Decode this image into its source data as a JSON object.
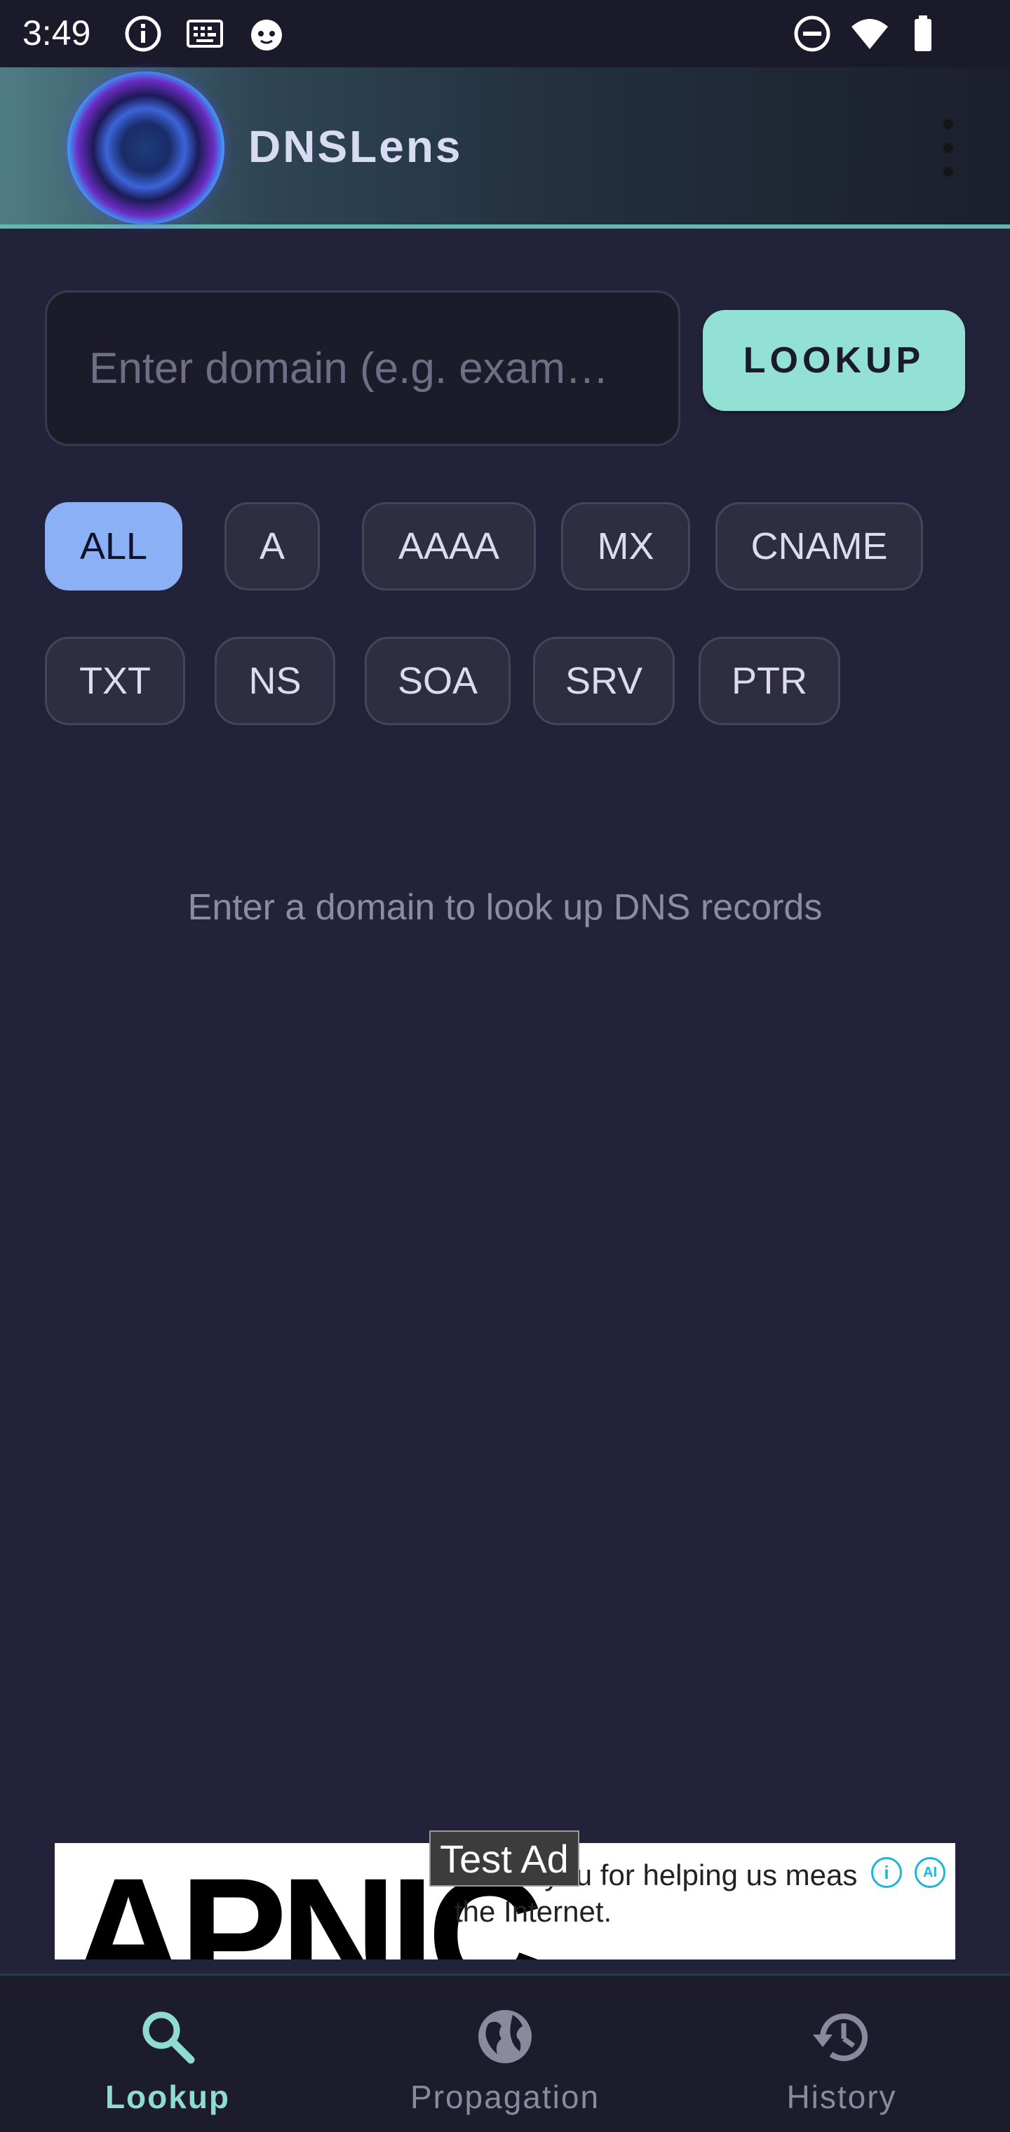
{
  "status_bar": {
    "time": "3:49",
    "left_icons": [
      "info-icon",
      "keyboard-icon",
      "cat-icon"
    ],
    "right_icons": [
      "do-not-disturb-icon",
      "wifi-icon",
      "battery-icon"
    ]
  },
  "app_bar": {
    "title": "DNSLens",
    "menu_icon": "more-vert-icon"
  },
  "search": {
    "placeholder": "Enter domain (e.g. exam…",
    "value": "",
    "button_label": "LOOKUP"
  },
  "record_types": [
    {
      "label": "ALL",
      "selected": true
    },
    {
      "label": "A",
      "selected": false
    },
    {
      "label": "AAAA",
      "selected": false
    },
    {
      "label": "MX",
      "selected": false
    },
    {
      "label": "CNAME",
      "selected": false
    },
    {
      "label": "TXT",
      "selected": false
    },
    {
      "label": "NS",
      "selected": false
    },
    {
      "label": "SOA",
      "selected": false
    },
    {
      "label": "SRV",
      "selected": false
    },
    {
      "label": "PTR",
      "selected": false
    }
  ],
  "empty_state": "Enter a domain to look up DNS records",
  "ad": {
    "badge": "Test Ad",
    "brand": "APNIC",
    "text_line1": "Thank you for helping us meas",
    "text_line2": "the Internet.",
    "info_icon": "ad-info-icon",
    "adchoices_icon": "adchoices-icon"
  },
  "bottom_nav": [
    {
      "label": "Lookup",
      "icon": "search-icon",
      "active": true
    },
    {
      "label": "Propagation",
      "icon": "globe-icon",
      "active": false
    },
    {
      "label": "History",
      "icon": "history-icon",
      "active": false
    }
  ],
  "colors": {
    "background": "#22223a",
    "accent": "#93e0d4",
    "chip_selected": "#8bb0f5"
  }
}
